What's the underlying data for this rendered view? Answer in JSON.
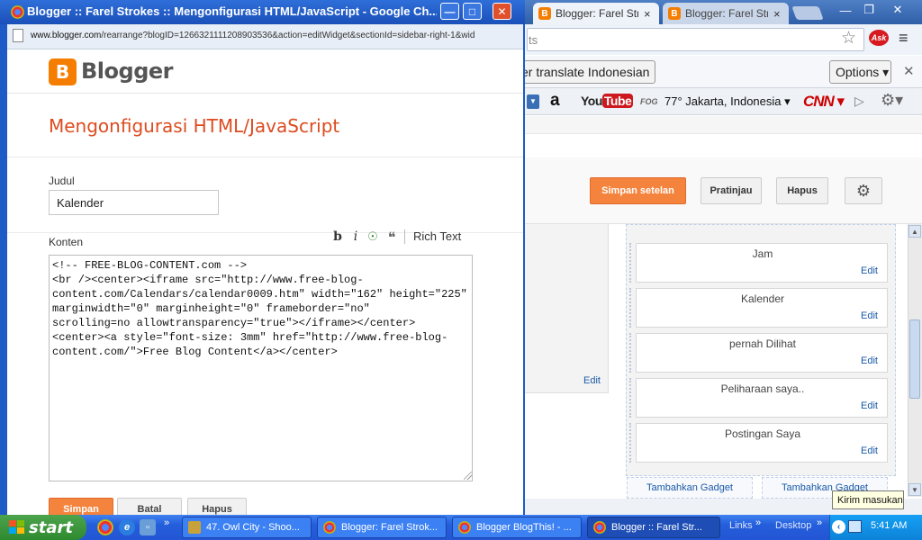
{
  "background_browser": {
    "tabs": [
      {
        "title": "Blogger: Farel Stro",
        "close": "×"
      },
      {
        "title": "Blogger: Farel Stro",
        "close": "×"
      }
    ],
    "omnibox_text": "ts",
    "translate_button": "er translate Indonesian",
    "options_button": "Options ▾",
    "toolbar": {
      "weather": "77° Jakarta, Indonesia ▾",
      "amazon": "a",
      "youtube_you": "You",
      "youtube_tube": "Tube",
      "fog": "FOG",
      "cnn": "CNN ▾"
    },
    "layout_actions": {
      "save": "Simpan setelan",
      "preview": "Pratinjau",
      "delete": "Hapus"
    },
    "left_edit": "Edit",
    "gadgets": [
      {
        "title": "Jam",
        "edit": "Edit"
      },
      {
        "title": "Kalender",
        "edit": "Edit"
      },
      {
        "title": "pernah Dilihat",
        "edit": "Edit"
      },
      {
        "title": "Peliharaan saya..",
        "edit": "Edit"
      },
      {
        "title": "Postingan Saya",
        "edit": "Edit"
      }
    ],
    "add_gadget_labels": [
      "Tambahkan Gadget",
      "Tambahkan Gadget"
    ]
  },
  "popup": {
    "window_title": "Blogger :: Farel Strokes :: Mengonfigurasi HTML/JavaScript - Google Ch...",
    "url_domain": "www.blogger.com",
    "url_path": "/rearrange?blogID=1266321111208903536&action=editWidget&sectionId=sidebar-right-1&wid",
    "logo_text": "Blogger",
    "page_title": "Mengonfigurasi HTML/JavaScript",
    "title_label": "Judul",
    "title_value": "Kalender",
    "content_label": "Konten",
    "format_buttons": {
      "bold": "b",
      "italic": "i",
      "quote": "❝"
    },
    "rich_text": "Rich Text",
    "content_code": "<!-- FREE-BLOG-CONTENT.com -->\n<br /><center><iframe src=\"http://www.free-blog-content.com/Calendars/calendar0009.htm\" width=\"162\" height=\"225\"\nmarginwidth=\"0\" marginheight=\"0\" frameborder=\"no\"\nscrolling=no allowtransparency=\"true\"></iframe></center>\n<center><a style=\"font-size: 3mm\" href=\"http://www.free-blog-content.com/\">Free Blog Content</a></center>",
    "buttons": {
      "save": "Simpan",
      "cancel": "Batal",
      "delete": "Hapus"
    }
  },
  "tooltip": "Kirim masukan",
  "taskbar": {
    "start": "start",
    "tasks": [
      {
        "label": "47. Owl City - Shoo...",
        "icon": "winamp"
      },
      {
        "label": "Blogger: Farel Strok...",
        "icon": "chrome"
      },
      {
        "label": "Blogger BlogThis! - ...",
        "icon": "chrome"
      },
      {
        "label": "Blogger :: Farel Str...",
        "icon": "chrome"
      }
    ],
    "links": "Links",
    "desktop": "Desktop",
    "chevron": "»",
    "tray_expand": "‹",
    "clock": "5:41 AM"
  },
  "colors": {
    "accent_orange": "#f4833d",
    "title_orange": "#dd4b1f",
    "link_blue": "#1a5aa8",
    "xp_blue": "#245edb"
  }
}
